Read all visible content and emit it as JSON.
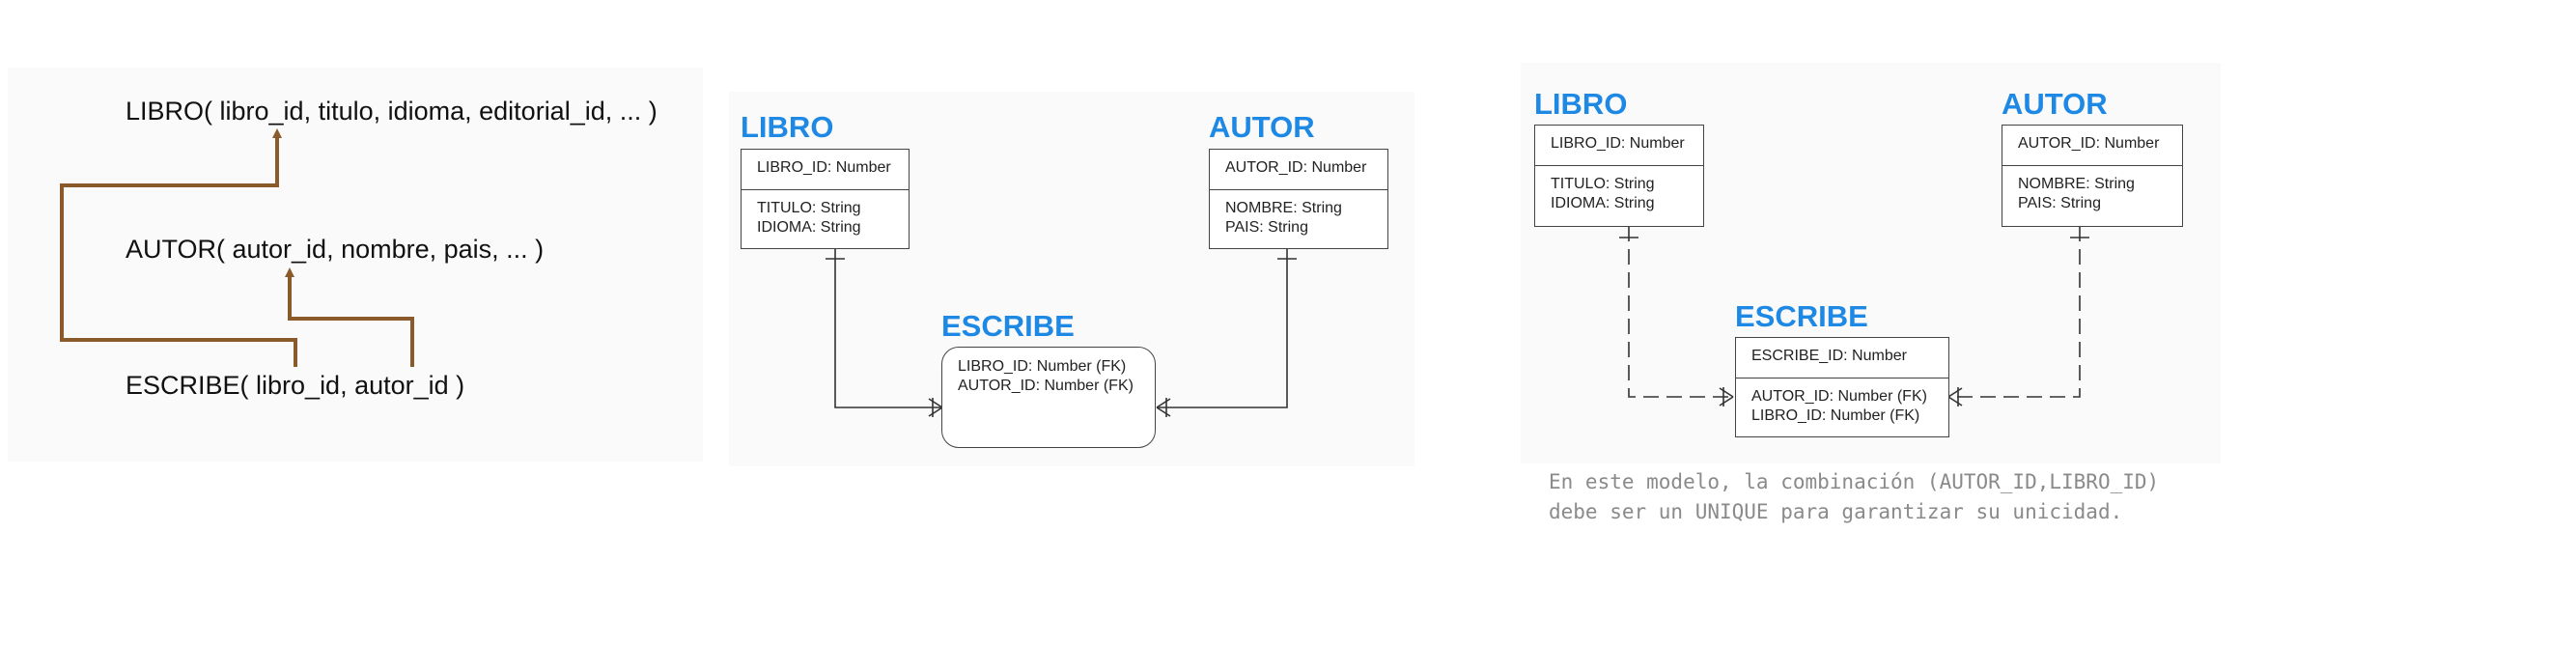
{
  "relational": {
    "libro": "LIBRO( libro_id, titulo, idioma, editorial_id, ... )",
    "autor": "AUTOR( autor_id, nombre, pais, ... )",
    "escribe": "ESCRIBE( libro_id, autor_id )"
  },
  "er1": {
    "libro": {
      "title": "LIBRO",
      "pk": "LIBRO_ID: Number",
      "attrs": [
        "TITULO: String",
        "IDIOMA: String"
      ]
    },
    "autor": {
      "title": "AUTOR",
      "pk": "AUTOR_ID: Number",
      "attrs": [
        "NOMBRE: String",
        "PAIS: String"
      ]
    },
    "escribe": {
      "title": "ESCRIBE",
      "attrs": [
        "LIBRO_ID: Number (FK)",
        "AUTOR_ID: Number (FK)"
      ]
    }
  },
  "er2": {
    "libro": {
      "title": "LIBRO",
      "pk": "LIBRO_ID: Number",
      "attrs": [
        "TITULO: String",
        "IDIOMA: String"
      ]
    },
    "autor": {
      "title": "AUTOR",
      "pk": "AUTOR_ID: Number",
      "attrs": [
        "NOMBRE: String",
        "PAIS: String"
      ]
    },
    "escribe": {
      "title": "ESCRIBE",
      "pk": "ESCRIBE_ID: Number",
      "attrs": [
        "AUTOR_ID: Number (FK)",
        "LIBRO_ID: Number (FK)"
      ]
    },
    "note": [
      "En este modelo, la combinación (AUTOR_ID,LIBRO_ID)",
      "debe ser un UNIQUE para garantizar su unicidad."
    ]
  },
  "colors": {
    "arrow": "#8b5a2b",
    "entity_title": "#1e88e5",
    "note": "#8a8a8a",
    "line": "#444444"
  }
}
